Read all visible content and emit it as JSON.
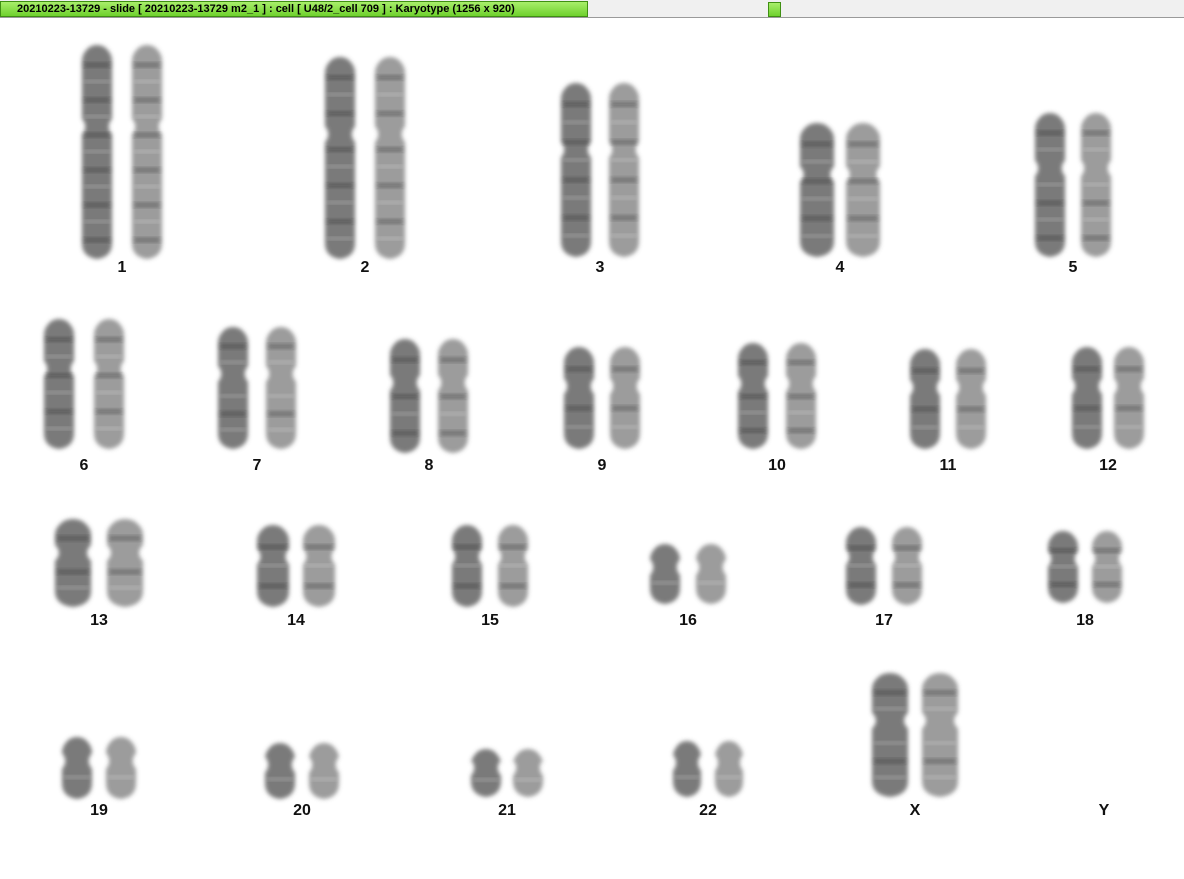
{
  "window": {
    "title": "20210223-13729 - slide [ 20210223-13729 m2_1 ] : cell [ U48/2_cell 709 ] : Karyotype  (1256 x 920)"
  },
  "colors": {
    "titlebar_accent": "#7fdc3a",
    "background": "#ffffff",
    "chromosome_ink": "#555555"
  },
  "karyotype": {
    "chromosomes": [
      {
        "label": "1",
        "count": 2
      },
      {
        "label": "2",
        "count": 2
      },
      {
        "label": "3",
        "count": 2
      },
      {
        "label": "4",
        "count": 2
      },
      {
        "label": "5",
        "count": 2
      },
      {
        "label": "6",
        "count": 2
      },
      {
        "label": "7",
        "count": 2
      },
      {
        "label": "8",
        "count": 2
      },
      {
        "label": "9",
        "count": 2
      },
      {
        "label": "10",
        "count": 2
      },
      {
        "label": "11",
        "count": 2
      },
      {
        "label": "12",
        "count": 2
      },
      {
        "label": "13",
        "count": 2
      },
      {
        "label": "14",
        "count": 2
      },
      {
        "label": "15",
        "count": 2
      },
      {
        "label": "16",
        "count": 2
      },
      {
        "label": "17",
        "count": 2
      },
      {
        "label": "18",
        "count": 2
      },
      {
        "label": "19",
        "count": 2
      },
      {
        "label": "20",
        "count": 2
      },
      {
        "label": "21",
        "count": 2
      },
      {
        "label": "22",
        "count": 2
      },
      {
        "label": "X",
        "count": 2
      },
      {
        "label": "Y",
        "count": 0
      }
    ]
  }
}
